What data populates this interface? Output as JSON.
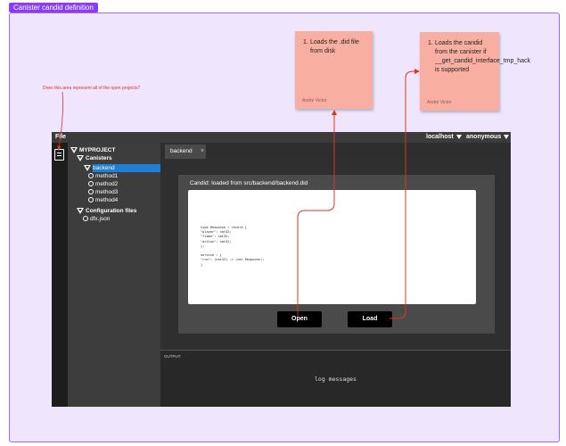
{
  "frame": {
    "label": "Canister candid definition"
  },
  "stickies": [
    {
      "number": "1.",
      "text": "Loads the .did file from disk",
      "author": "André Victor"
    },
    {
      "number": "1.",
      "text": "Loads the candid from the canister if __get_candid_interface_tmp_hack is supported",
      "author": "André Victor"
    }
  ],
  "annotation": {
    "question": "Does this area represent all of the open projects?"
  },
  "topbar": {
    "menu": "File",
    "network": "localhost",
    "user": "anonymous"
  },
  "explorer": {
    "project": "MYPROJECT",
    "canisters_label": "Canisters",
    "canister": "backend",
    "methods": [
      "method1",
      "method2",
      "method3",
      "method4"
    ],
    "config_label": "Configuration files",
    "config_file": "dfx.json"
  },
  "tabs": [
    {
      "label": "backend",
      "close": "×"
    }
  ],
  "editor": {
    "panel_title": "Candid: loaded from src/backend/backend.did",
    "code": "type Response = record {\n\"player\": nat32;\n\"frame\": nat32;\n\"action\": nat32;\n};\n\nservice : {\n\"run\": (nat32) -> (vec Response);\n}",
    "open_label": "Open",
    "load_label": "Load"
  },
  "output": {
    "label": "OUTPUT",
    "log": "log messages"
  },
  "colors": {
    "accent": "#8b3df5",
    "arrow": "#e0321c",
    "selection": "#1e7fd4",
    "sticky": "#f9aea2"
  }
}
